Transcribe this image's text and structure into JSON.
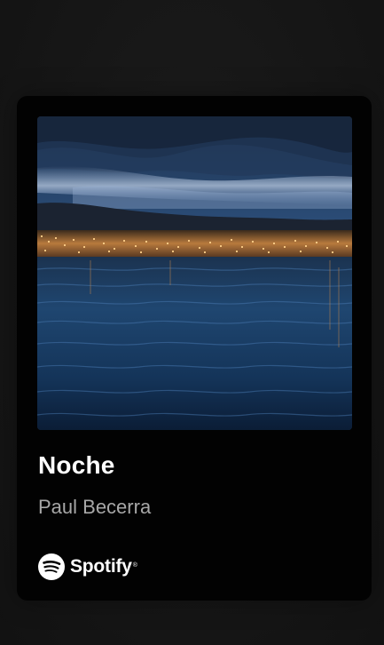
{
  "track": {
    "title": "Noche",
    "artist": "Paul Becerra",
    "cover_icon": "night-lake-album-art"
  },
  "brand": {
    "name": "Spotify",
    "registered_mark": "®",
    "icon": "spotify-logo-icon"
  },
  "colors": {
    "background": "#151515",
    "card": "#020202",
    "title": "#ffffff",
    "artist": "#a7a7a7"
  }
}
